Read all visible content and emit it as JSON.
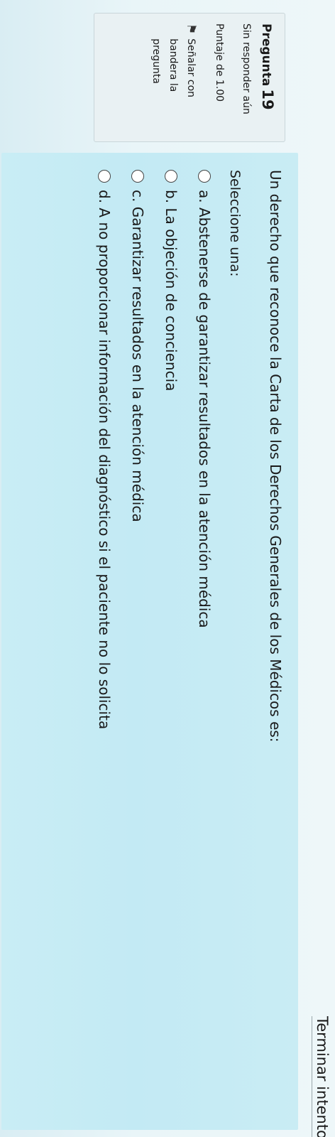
{
  "question_info": {
    "label": "Pregunta",
    "number": "19",
    "status": "Sin responder aún",
    "grade": "Puntaje de 1.00",
    "flag_label": "Señalar con bandera la pregunta"
  },
  "question": {
    "text": "Un derecho que reconoce la Carta de los Derechos Generales de los Médicos es:",
    "instruction": "Seleccione una:",
    "options": [
      {
        "label": "a. Abstenerse de garantizar resultados en la atención médica",
        "selected": false
      },
      {
        "label": "b. La objeción de conciencia",
        "selected": false
      },
      {
        "label": "c. Garantizar resultados en la atención médica",
        "selected": false
      },
      {
        "label": "d. A no proporcionar información del diagnóstico si el paciente no lo solicita",
        "selected": false
      }
    ]
  },
  "navigation": {
    "finish_label": "Terminar intento ..."
  },
  "icons": {
    "flag": "flag-icon",
    "radio": "radio-unchecked-icon"
  }
}
